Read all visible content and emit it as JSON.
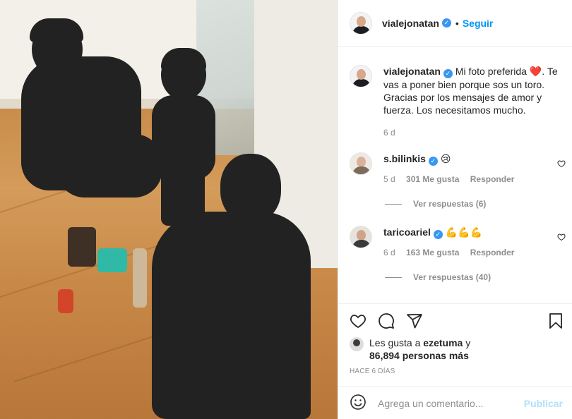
{
  "header": {
    "username": "vialejonatan",
    "follow_label": "Seguir",
    "separator": "•"
  },
  "caption": {
    "username": "vialejonatan",
    "text_line1": "Mi foto preferida ❤️.",
    "text_rest": "Te vas a poner bien porque sos un toro. Gracias por los mensajes de amor y fuerza. Los necesitamos mucho.",
    "time": "6 d"
  },
  "comments": [
    {
      "username": "s.bilinkis",
      "text": "😢",
      "time": "5 d",
      "likes": "301 Me gusta",
      "reply_label": "Responder",
      "view_replies": "Ver respuestas (6)"
    },
    {
      "username": "taricoariel",
      "text": "💪💪💪",
      "time": "6 d",
      "likes": "163 Me gusta",
      "reply_label": "Responder",
      "view_replies": "Ver respuestas (40)"
    }
  ],
  "likes": {
    "prefix": "Les gusta a",
    "user": "ezetuma",
    "suffix": "y",
    "count_text": "86,894 personas más"
  },
  "time_ago": "HACE 6 DÍAS",
  "add_comment": {
    "placeholder": "Agrega un comentario...",
    "publish_label": "Publicar"
  },
  "colors": {
    "link_blue": "#0095f6",
    "verified_blue": "#3897f0",
    "publish_disabled": "#b2dffc",
    "muted_text": "#8e8e8e"
  },
  "icons": [
    "heart-icon",
    "comment-icon",
    "share-icon",
    "bookmark-icon",
    "smiley-icon",
    "verified-icon"
  ]
}
